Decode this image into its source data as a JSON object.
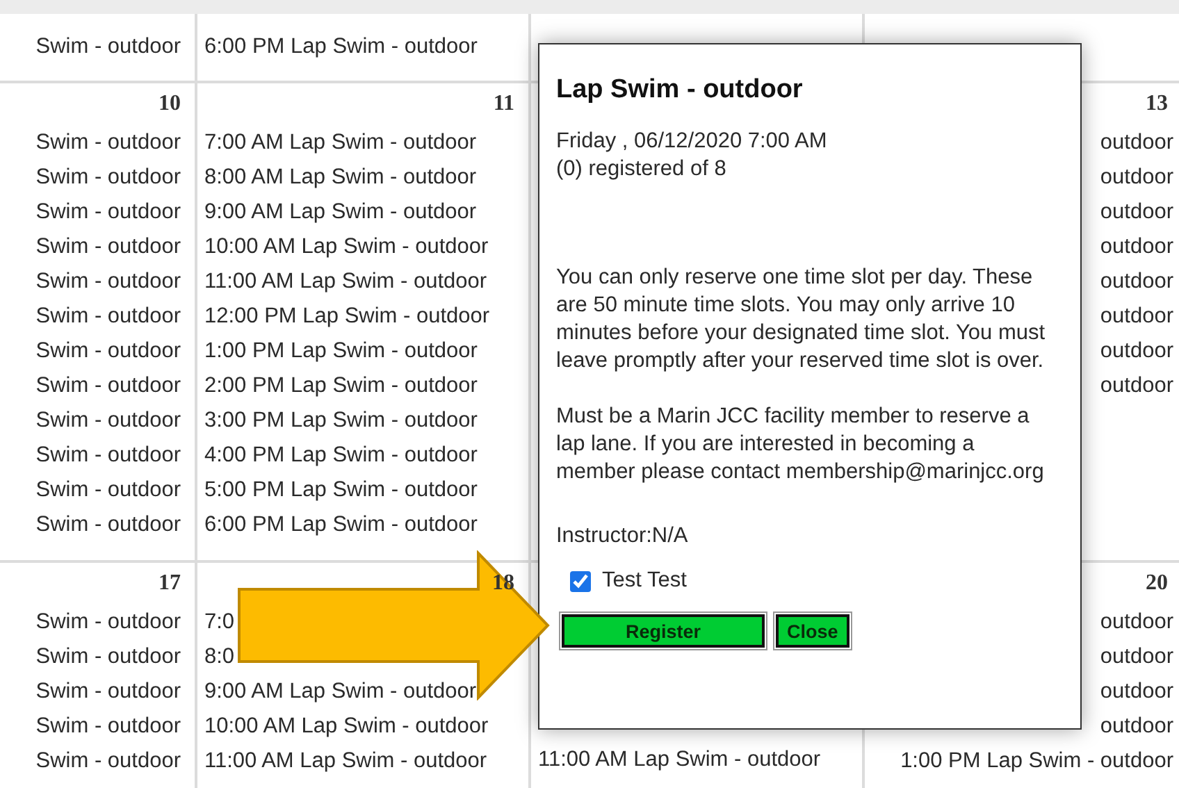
{
  "weeks": [
    {
      "cells": [
        {
          "entries": [
            "Swim - outdoor"
          ]
        },
        {
          "entries": [
            "6:00 PM Lap Swim - outdoor"
          ]
        },
        {},
        {}
      ]
    },
    {
      "cells": [
        {
          "day": "10",
          "entries": [
            "Swim - outdoor",
            "Swim - outdoor",
            "Swim - outdoor",
            "Swim - outdoor",
            "Swim - outdoor",
            "Swim - outdoor",
            "Swim - outdoor",
            "Swim - outdoor",
            "Swim - outdoor",
            "Swim - outdoor",
            "Swim - outdoor",
            "Swim - outdoor"
          ]
        },
        {
          "day": "11",
          "entries": [
            "7:00 AM Lap Swim - outdoor",
            "8:00 AM Lap Swim - outdoor",
            "9:00 AM Lap Swim - outdoor",
            "10:00 AM Lap Swim - outdoor",
            "11:00 AM Lap Swim - outdoor",
            "12:00 PM Lap Swim - outdoor",
            "1:00 PM Lap Swim - outdoor",
            "2:00 PM Lap Swim - outdoor",
            "3:00 PM Lap Swim - outdoor",
            "4:00 PM Lap Swim - outdoor",
            "5:00 PM Lap Swim - outdoor",
            "6:00 PM Lap Swim - outdoor"
          ]
        },
        {},
        {
          "day": "13",
          "entries": [
            "outdoor",
            "outdoor",
            "outdoor",
            "outdoor",
            "outdoor",
            "outdoor",
            "outdoor",
            "outdoor"
          ]
        }
      ]
    },
    {
      "cells": [
        {
          "day": "17",
          "entries": [
            "Swim - outdoor",
            "Swim - outdoor",
            "Swim - outdoor",
            "Swim - outdoor",
            "Swim - outdoor"
          ]
        },
        {
          "day": "18",
          "entries": [
            "7:0",
            "8:0",
            "9:00 AM Lap Swim - outdoor",
            "10:00 AM Lap Swim - outdoor",
            "11:00 AM Lap Swim - outdoor"
          ]
        },
        {
          "entries": [
            "11:00 AM Lap Swim - outdoor"
          ]
        },
        {
          "day": "20",
          "entries": [
            "outdoor",
            "outdoor",
            "outdoor",
            "outdoor",
            "1:00 PM Lap Swim - outdoor"
          ]
        }
      ]
    }
  ],
  "popup": {
    "title": "Lap Swim - outdoor",
    "date": "Friday , 06/12/2020 7:00 AM",
    "registered": "(0) registered of 8",
    "paragraphs": [
      "You can only reserve one time slot per day. These are 50 minute time slots. You may only arrive 10 minutes before your designated time slot. You must leave promptly after your reserved time slot is over.",
      "Must be a Marin JCC facility member to reserve a lap lane. If you are interested in becoming a member please contact membership@marinjcc.org"
    ],
    "instructor": "Instructor:N/A",
    "attendees": [
      {
        "name": "Test Test",
        "checked": true
      }
    ],
    "buttons": [
      "Register",
      "Close"
    ]
  }
}
